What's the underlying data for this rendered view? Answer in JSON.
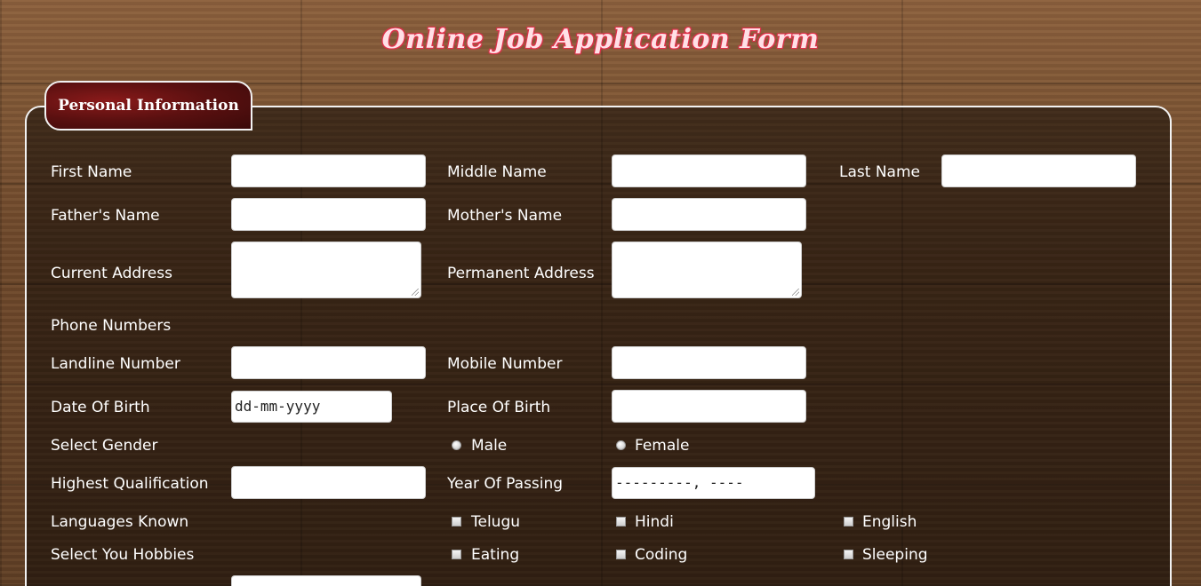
{
  "page": {
    "title": "Online Job Application Form"
  },
  "section": {
    "tab_label": "Personal Information"
  },
  "fields": {
    "first_name": "First Name",
    "middle_name": "Middle Name",
    "last_name": "Last Name",
    "fathers_name": "Father's Name",
    "mothers_name": "Mother's Name",
    "current_address": "Current Address",
    "permanent_address": "Permanent Address",
    "phone_numbers": "Phone Numbers",
    "landline_number": "Landline Number",
    "mobile_number": "Mobile Number",
    "date_of_birth": "Date Of Birth",
    "date_of_birth_placeholder": "dd-mm-yyyy",
    "place_of_birth": "Place Of Birth",
    "select_gender": "Select Gender",
    "highest_qualification": "Highest Qualification",
    "year_of_passing": "Year Of Passing",
    "year_of_passing_placeholder": "---------, ----",
    "languages_known": "Languages Known",
    "select_hobbies": "Select You Hobbies"
  },
  "gender_options": [
    "Male",
    "Female"
  ],
  "languages": [
    "Telugu",
    "Hindi",
    "English"
  ],
  "hobbies": [
    "Eating",
    "Coding",
    "Sleeping"
  ],
  "colors": {
    "title_outline": "#e0304a",
    "tab_background": "#5a1010",
    "panel_border": "#f2f2f2"
  }
}
